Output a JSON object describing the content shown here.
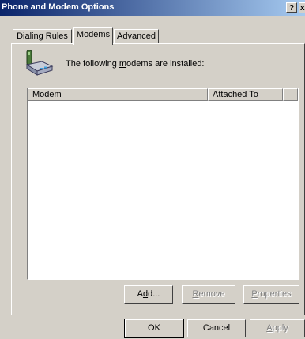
{
  "window": {
    "title": "Phone and Modem Options",
    "help_label": "?",
    "close_label": "x"
  },
  "tabs": [
    {
      "label": "Dialing Rules",
      "active": false
    },
    {
      "label": "Modems",
      "active": true
    },
    {
      "label": "Advanced",
      "active": false
    }
  ],
  "panel": {
    "description_pre": "The following ",
    "description_link": "m",
    "description_post": "odems are  installed:",
    "icon": "modem-phone-icon",
    "columns": [
      "Modem",
      "Attached To"
    ],
    "rows": []
  },
  "panel_buttons": {
    "add": {
      "prefix": "A",
      "accel": "d",
      "suffix": "d...",
      "enabled": true
    },
    "remove": {
      "prefix": "",
      "accel": "R",
      "suffix": "emove",
      "enabled": false
    },
    "properties": {
      "prefix": "",
      "accel": "P",
      "suffix": "roperties",
      "enabled": false
    }
  },
  "dialog_buttons": {
    "ok": "OK",
    "cancel": "Cancel",
    "apply_accel": "A",
    "apply_suffix": "pply"
  }
}
